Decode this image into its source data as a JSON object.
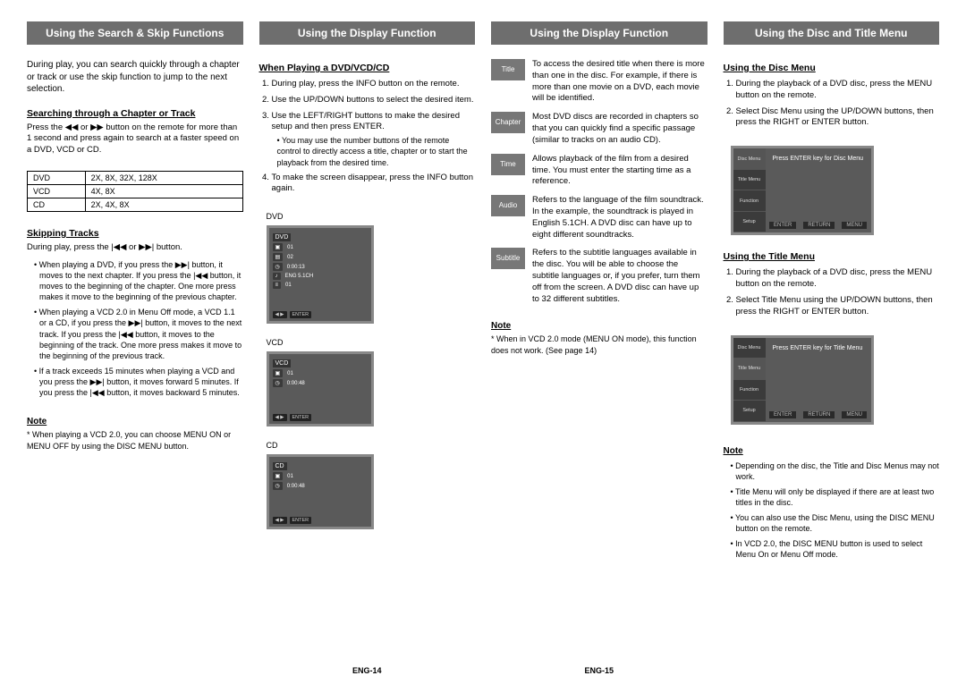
{
  "columns": [
    {
      "header": "Using the Search & Skip Functions",
      "intro": "During play, you can search quickly through a chapter or track or use the skip function to jump to the next selection.",
      "section1": {
        "title": "Searching through a Chapter or Track",
        "text": "Press the  ◀◀  or  ▶▶  button on the remote for more than 1 second and press again to search at a faster speed on a DVD, VCD or CD.",
        "table": [
          [
            "DVD",
            "2X, 8X, 32X, 128X"
          ],
          [
            "VCD",
            "4X, 8X"
          ],
          [
            "CD",
            "2X, 4X, 8X"
          ]
        ]
      },
      "section2": {
        "title": "Skipping Tracks",
        "text": "During play, press the  |◀◀  or  ▶▶|  button.",
        "bullets": [
          "When playing a DVD, if you press the ▶▶| button, it moves to the next chapter. If you press the |◀◀ button, it moves to the beginning of the chapter. One more press makes it move to the beginning of the previous chapter.",
          "When playing a VCD 2.0 in Menu Off mode, a VCD 1.1 or a CD, if you press the ▶▶| button, it moves to the next track. If you press the |◀◀ button, it moves to the beginning of the track. One more press makes it move to the beginning of the previous track.",
          "If a track exceeds 15 minutes when playing a VCD and you press the ▶▶| button, it moves forward 5 minutes. If you press the |◀◀ button, it moves backward 5 minutes."
        ]
      },
      "note": {
        "title": "Note",
        "text": "* When playing a VCD 2.0, you can choose MENU ON or MENU OFF by using the DISC MENU button."
      }
    },
    {
      "header": "Using the Display Function",
      "section1": {
        "title": "When Playing a DVD/VCD/CD",
        "steps": [
          "During play, press the INFO button on the remote.",
          "Use the UP/DOWN buttons to select the desired item.",
          "Use the LEFT/RIGHT buttons to make the desired setup and then press ENTER.",
          "To make the screen disappear, press the INFO button again."
        ],
        "step3_sub": "• You may use the number buttons of the remote control to directly access a title, chapter or to start the playback from the desired time."
      },
      "screens": {
        "dvd_label": "DVD",
        "vcd_label": "VCD",
        "cd_label": "CD",
        "dvd": {
          "top": "DVD",
          "rows": [
            "01",
            "02",
            "0:00:13",
            "ENG 5.1CH",
            "01"
          ],
          "btns": [
            "ENTER"
          ]
        },
        "vcd": {
          "top": "VCD",
          "rows": [
            "01",
            "0:00:48"
          ],
          "btns": [
            "ENTER"
          ]
        },
        "cd": {
          "top": "CD",
          "rows": [
            "01",
            "0:00:48"
          ],
          "btns": [
            "ENTER"
          ]
        }
      }
    },
    {
      "header": "Using the Display Function",
      "items": [
        {
          "icon": "Title",
          "text": "To access the desired title when there is more than one in the disc.\nFor example, if there is more than one movie on a DVD, each movie will be identified."
        },
        {
          "icon": "Chapter",
          "text": "Most DVD discs are recorded in chapters so that you can quickly find a specific passage (similar to tracks on an audio CD)."
        },
        {
          "icon": "Time",
          "text": "Allows playback of the film from a desired time. You must enter the starting time as a reference."
        },
        {
          "icon": "Audio",
          "text": "Refers to the language of the film soundtrack. In the example, the soundtrack is played in English 5.1CH.\nA DVD disc can have up to eight different soundtracks."
        },
        {
          "icon": "Subtitle",
          "text": "Refers to the subtitle languages available in the disc.\nYou will be able to choose the subtitle languages or, if you prefer, turn them off from the screen.\nA DVD disc can have up to 32 different subtitles."
        }
      ],
      "note": {
        "title": "Note",
        "text": "* When in VCD 2.0 mode (MENU ON mode), this function does not work. (See page 14)"
      }
    },
    {
      "header": "Using the Disc and Title Menu",
      "disc": {
        "title": "Using the Disc Menu",
        "steps": [
          "During the playback of a DVD disc, press the MENU button on the remote.",
          "Select Disc Menu using the UP/DOWN buttons, then press the RIGHT or ENTER button."
        ],
        "screen_text": "Press ENTER key for Disc Menu",
        "menu_items": [
          "Disc Menu",
          "Title Menu",
          "Function",
          "Setup"
        ],
        "btns": [
          "ENTER",
          "RETURN",
          "MENU"
        ]
      },
      "title_menu": {
        "title": "Using the Title Menu",
        "steps": [
          "During the playback of a DVD disc, press the MENU button on the remote.",
          "Select Title Menu using the UP/DOWN buttons, then press the RIGHT or ENTER button."
        ],
        "screen_text": "Press ENTER key for Title Menu",
        "menu_items": [
          "Disc Menu",
          "Title Menu",
          "Function",
          "Setup"
        ],
        "btns": [
          "ENTER",
          "RETURN",
          "MENU"
        ]
      },
      "note": {
        "title": "Note",
        "bullets": [
          "Depending on the disc, the Title and Disc Menus may not work.",
          "Title Menu will only be displayed if there are at least two titles in the disc.",
          "You can also use the Disc Menu, using the DISC MENU button on the remote.",
          "In VCD 2.0, the DISC MENU button is used to select Menu On or Menu Off mode."
        ]
      }
    }
  ],
  "footer": {
    "left": "ENG-14",
    "right": "ENG-15"
  }
}
